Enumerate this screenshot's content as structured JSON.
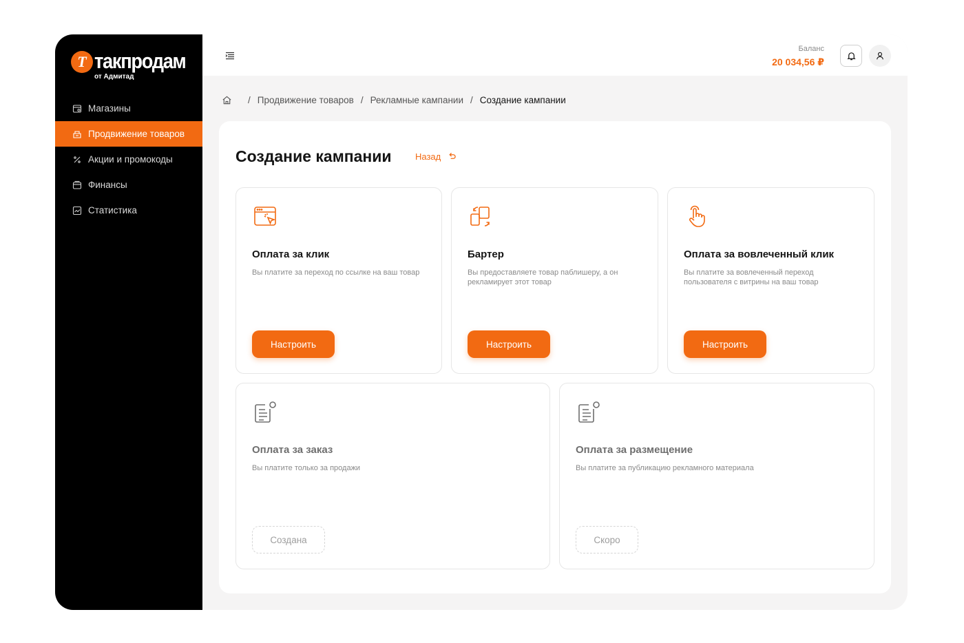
{
  "brand": {
    "logo_mark": "Т",
    "name": "такпродам",
    "subtitle": "от Адмитад",
    "accent_color": "#f26a12"
  },
  "sidebar": {
    "items": [
      {
        "label": "Магазины",
        "icon": "store-icon",
        "active": false
      },
      {
        "label": "Продвижение товаров",
        "icon": "promotion-icon",
        "active": true
      },
      {
        "label": "Акции и промокоды",
        "icon": "percent-icon",
        "active": false
      },
      {
        "label": "Финансы",
        "icon": "wallet-icon",
        "active": false
      },
      {
        "label": "Статистика",
        "icon": "chart-icon",
        "active": false
      }
    ]
  },
  "topbar": {
    "menu_icon": "menu-collapse-icon",
    "balance_label": "Баланс",
    "balance_value": "20 034,56 ₽",
    "notifications_icon": "bell-icon",
    "profile_icon": "user-icon"
  },
  "breadcrumb": {
    "home_icon": "home-icon",
    "separator": "/",
    "items": [
      "Продвижение товаров",
      "Рекламные кампании",
      "Создание кампании"
    ]
  },
  "page": {
    "title": "Создание кампании",
    "back_label": "Назад"
  },
  "cards": [
    {
      "icon": "browser-click-icon",
      "title": "Оплата за клик",
      "description": "Вы платите за переход по ссылке на ваш товар",
      "button": "Настроить",
      "state": "enabled"
    },
    {
      "icon": "barter-exchange-icon",
      "title": "Бартер",
      "description": "Вы предоставляете товар паблишеру, а он рекламирует этот товар",
      "button": "Настроить",
      "state": "enabled"
    },
    {
      "icon": "hand-pointer-icon",
      "title": "Оплата за вовлеченный клик",
      "description": "Вы платите за вовлеченный переход пользователя с витрины на ваш товар",
      "button": "Настроить",
      "state": "enabled"
    },
    {
      "icon": "document-list-icon",
      "title": "Оплата за заказ",
      "description": "Вы платите только за продажи",
      "button": "Создана",
      "state": "disabled"
    },
    {
      "icon": "document-list-icon",
      "title": "Оплата за размещение",
      "description": "Вы платите за публикацию рекламного материала",
      "button": "Скоро",
      "state": "disabled"
    }
  ]
}
